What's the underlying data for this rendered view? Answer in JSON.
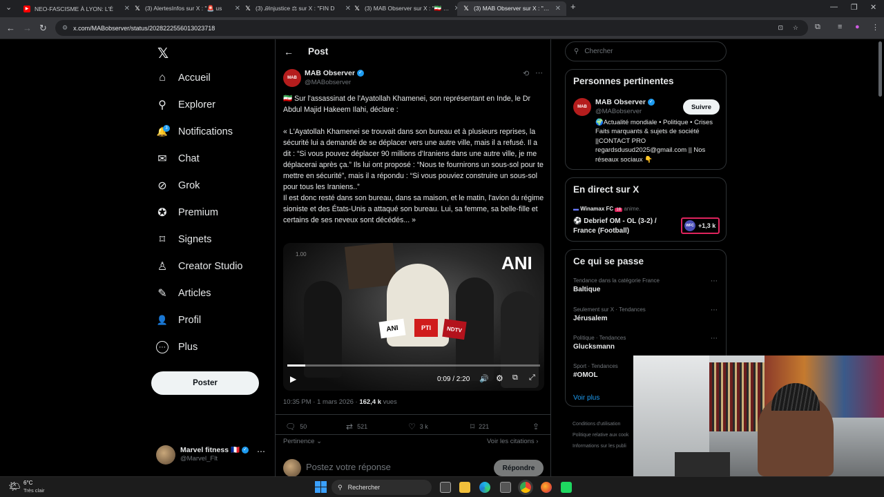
{
  "browser": {
    "tabs": [
      {
        "title": "NEO-FASCISME À LYON: L'É",
        "icon": "youtube-icon",
        "color": "#ff0000"
      },
      {
        "title": "(3) AlertesInfos sur X : \"🚨 us",
        "icon": "x-logo-icon",
        "color": "#ffffff"
      },
      {
        "title": "(3) ᎯInjustice ⚖ sur X : \"FIN D",
        "icon": "x-logo-icon",
        "color": "#ffffff"
      },
      {
        "title": "(3) MAB Observer sur X : \"🇮🇷 Sur",
        "icon": "x-logo-icon",
        "color": "#ffffff"
      },
      {
        "title": "(3) MAB Observer sur X : \"🇮🇷 Su",
        "icon": "x-logo-icon",
        "color": "#ffffff"
      }
    ],
    "url": "x.com/MABobserver/status/2028222556013023718"
  },
  "nav": {
    "items": [
      {
        "label": "Accueil",
        "icon": "home-icon",
        "glyph": "⌂"
      },
      {
        "label": "Explorer",
        "icon": "search-icon",
        "glyph": "⚲"
      },
      {
        "label": "Notifications",
        "icon": "bell-icon",
        "glyph": "🔔"
      },
      {
        "label": "Chat",
        "icon": "mail-icon",
        "glyph": "✉"
      },
      {
        "label": "Grok",
        "icon": "grok-icon",
        "glyph": "⊘"
      },
      {
        "label": "Premium",
        "icon": "premium-icon",
        "glyph": "✪"
      },
      {
        "label": "Signets",
        "icon": "bookmark-icon",
        "glyph": "⌑"
      },
      {
        "label": "Creator Studio",
        "icon": "creator-icon",
        "glyph": "♙"
      },
      {
        "label": "Articles",
        "icon": "article-icon",
        "glyph": "✎"
      },
      {
        "label": "Profil",
        "icon": "profile-icon",
        "glyph": "👤"
      },
      {
        "label": "Plus",
        "icon": "more-icon",
        "glyph": "⋯"
      }
    ],
    "notif_badge": "3",
    "post_button": "Poster",
    "account_name": "Marvel fitness 🇫🇷",
    "account_handle": "@Marvel_Flt"
  },
  "post": {
    "header": "Post",
    "author_name": "MAB Observer",
    "author_handle": "@MABobserver",
    "intro": "🇮🇷 Sur l'assassinat de l'Ayatollah Khamenei, son représentant en Inde, le Dr Abdul Majid Hakeem Ilahi, déclare :",
    "quote": "« L'Ayatollah Khamenei se trouvait dans son bureau et à plusieurs reprises, la sécurité lui a demandé de se déplacer vers une autre ville, mais il a refusé. Il a dit : “Si vous pouvez déplacer 90 millions d'Iraniens dans une autre ville, je me déplacerai après ça.” Ils lui ont proposé : “Nous te fournirons un sous-sol pour te mettre en sécurité”, mais il a répondu : “Si vous pouviez construire un sous-sol pour tous les Iraniens..”",
    "rest": "Il est donc resté dans son bureau, dans sa maison, et le matin, l'avion du régime sioniste et des États-Unis a attaqué son bureau. Lui, sa femme, sa belle-fille et certains de ses neveux sont décédés... »",
    "video": {
      "watermark": "ANI",
      "speed": "1.00",
      "time": "0:09 / 2:20",
      "progress": 0.07,
      "mic_labels": [
        "ANI",
        "PTI",
        "NDTV"
      ]
    },
    "meta_time": "10:35 PM · 1 mars 2026 · ",
    "meta_views": "162,4 k",
    "meta_views_label": " vues",
    "stats": {
      "replies": "50",
      "reposts": "521",
      "likes": "3 k",
      "bookmarks": "221"
    },
    "sort_label": "Pertinence",
    "citations_label": "Voir les citations",
    "reply_placeholder": "Postez votre réponse",
    "reply_button": "Répondre"
  },
  "sidebar": {
    "search_placeholder": "Chercher",
    "relevant": {
      "title": "Personnes pertinentes",
      "name": "MAB Observer",
      "handle": "@MABobserver",
      "follow": "Suivre",
      "bio": "🌍Actualité mondiale • Politique • Crises Faits marquants & sujets de société ||CONTACT PRO regardsdusud2025@gmail.com || Nos réseaux sociaux 👇"
    },
    "live": {
      "title": "En direct sur X",
      "host": "Winamax FC",
      "age": "18",
      "anime": "anime.",
      "stream_title": "⚽ Debrief OM - OL (3-2) / France (Football)",
      "listeners": "+1,3 k",
      "logo": "WFC"
    },
    "happening": {
      "title": "Ce qui se passe",
      "trends": [
        {
          "category": "Tendance dans la catégorie France",
          "name": "Baltique"
        },
        {
          "category": "Seulement sur X · Tendances",
          "name": "Jérusalem"
        },
        {
          "category": "Politique · Tendances",
          "name": "Glucksmann"
        },
        {
          "category": "Sport · Tendances",
          "name": "#OMOL"
        }
      ],
      "more": "Voir plus"
    },
    "footer": [
      "Conditions d'utilisation",
      "Politique relative aux cook",
      "Informations sur les publi"
    ]
  },
  "taskbar": {
    "temp": "6°C",
    "weather": "Très clair",
    "search": "Rechercher"
  }
}
